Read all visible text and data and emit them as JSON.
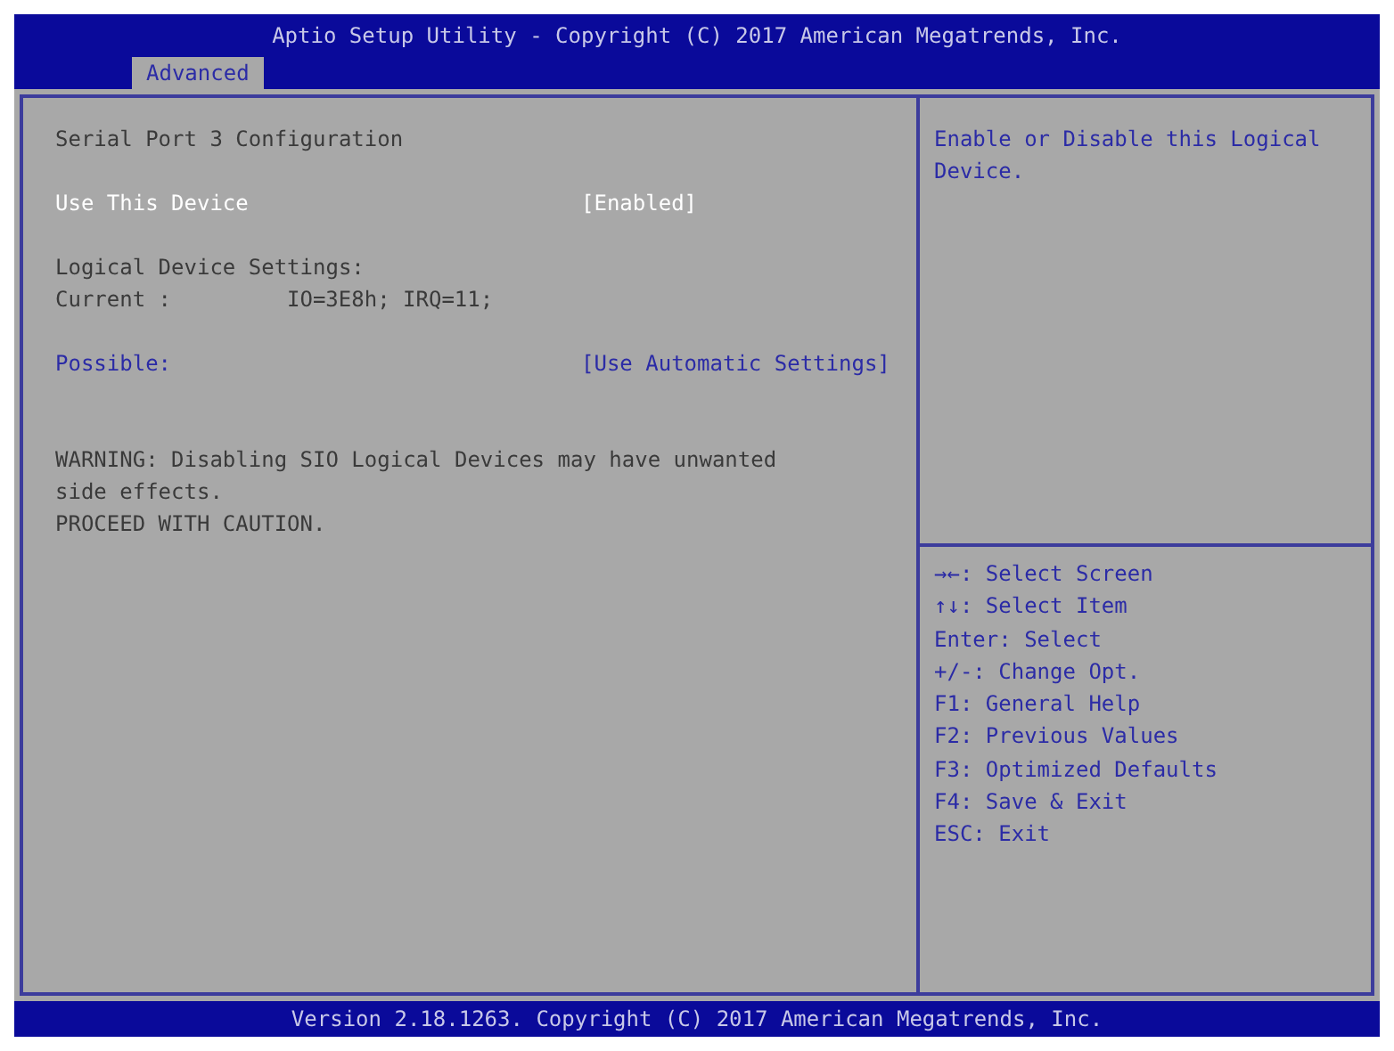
{
  "header": {
    "title": "Aptio Setup Utility - Copyright (C) 2017 American Megatrends, Inc.",
    "tabs": [
      {
        "label": "Advanced",
        "selected": true
      }
    ]
  },
  "main": [
    {
      "kind": "text",
      "text": "Serial Port 3 Configuration"
    },
    {
      "kind": "gap"
    },
    {
      "kind": "option",
      "label": "Use This Device",
      "value": "[Enabled]",
      "selected": true
    },
    {
      "kind": "gap"
    },
    {
      "kind": "text",
      "text": "Logical Device Settings:"
    },
    {
      "kind": "field",
      "label": "Current :",
      "value": "IO=3E8h; IRQ=11;"
    },
    {
      "kind": "gap"
    },
    {
      "kind": "option",
      "label": "Possible:",
      "value": "[Use Automatic Settings]",
      "selected": false
    },
    {
      "kind": "gap"
    },
    {
      "kind": "gap"
    },
    {
      "kind": "warning",
      "text": "WARNING: Disabling SIO Logical Devices may have unwanted side effects."
    },
    {
      "kind": "text",
      "text": "PROCEED WITH CAUTION."
    }
  ],
  "help": {
    "text": "Enable or Disable this Logical Device.",
    "keys": [
      "→←: Select Screen",
      "↑↓: Select Item",
      "Enter: Select",
      "+/-: Change Opt.",
      "F1: General Help",
      "F2: Previous Values",
      "F3: Optimized Defaults",
      "F4: Save & Exit",
      "ESC: Exit"
    ]
  },
  "footer": "Version 2.18.1263. Copyright (C) 2017 American Megatrends, Inc."
}
